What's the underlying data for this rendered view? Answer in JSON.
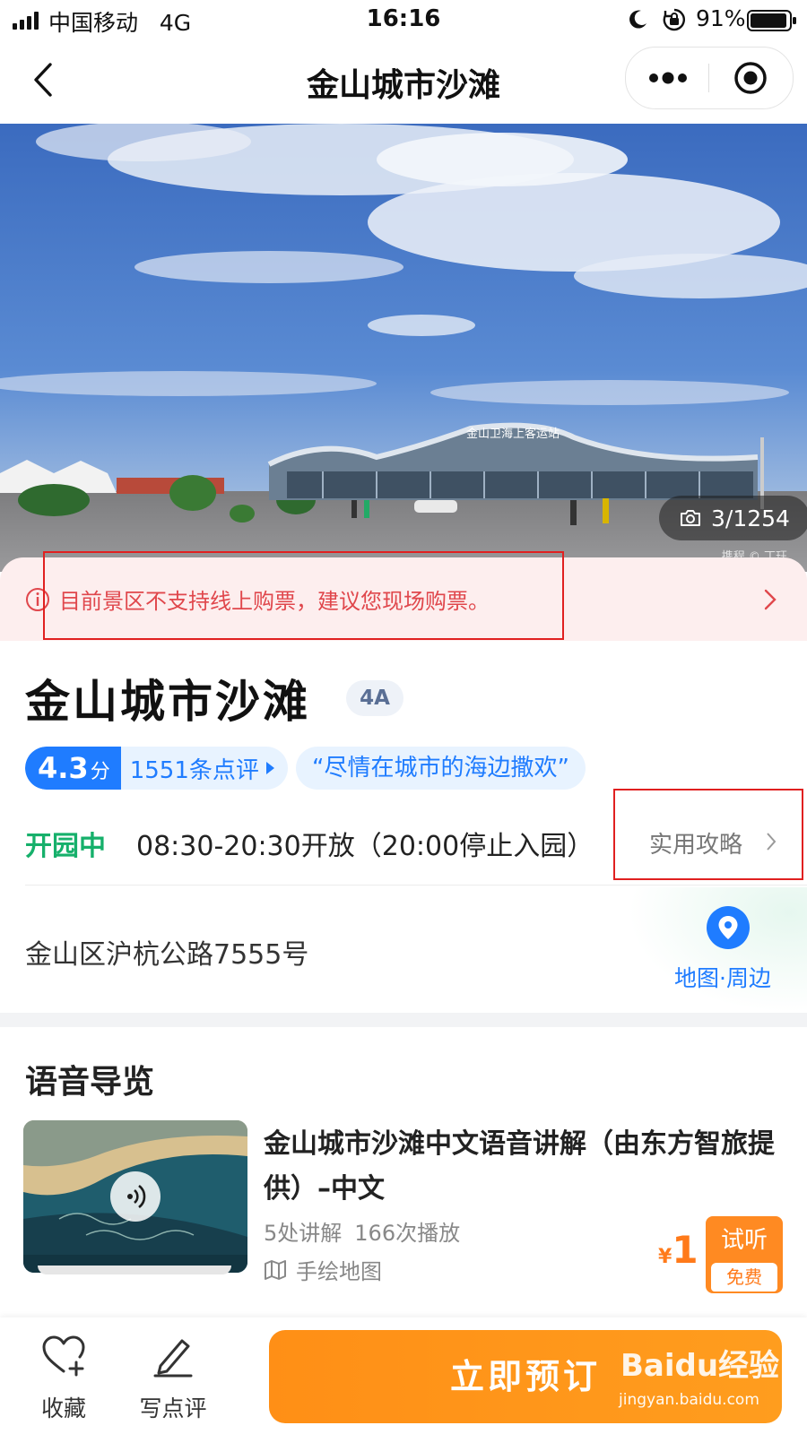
{
  "status_bar": {
    "carrier": "中国移动",
    "network": "4G",
    "time": "16:16",
    "battery_percent": "91%"
  },
  "nav": {
    "title": "金山城市沙滩",
    "icons": [
      "back-arrow-icon",
      "more-dots-icon",
      "target-circle-icon"
    ]
  },
  "hero": {
    "photo_counter": "3/1254",
    "building_sign": "金山卫海上客运站",
    "watermark": "携程 © 丁玨"
  },
  "notice": {
    "text": "目前景区不支持线上购票，建议您现场购票。"
  },
  "spot": {
    "name": "金山城市沙滩",
    "level": "4A",
    "score": "4.3",
    "score_unit": "分",
    "review_count": "1551条点评",
    "slogan": "“尽情在城市的海边撒欢”",
    "open_status": "开园中",
    "hours": "08:30-20:30开放（20:00停止入园）",
    "guide_link": "实用攻略",
    "address": "金山区沪杭公路7555号",
    "map_label": "地图·周边"
  },
  "audio": {
    "section_title": "语音导览",
    "title": "金山城市沙滩中文语音讲解（由东方智旅提供）–中文",
    "stats": [
      "5处讲解",
      "166次播放"
    ],
    "hand_map": "手绘地图",
    "price_symbol": "¥",
    "price": "1",
    "listen_label": "试听",
    "free_label": "免费"
  },
  "bottom": {
    "favorite_label": "收藏",
    "review_label": "写点评",
    "book_label": "立即预订"
  },
  "watermark": {
    "brand": "Baidu经验",
    "url": "jingyan.baidu.com"
  },
  "colors": {
    "accent_blue": "#1f7cff",
    "open_green": "#16b06b",
    "notice_red": "#e0474c",
    "orange": "#ff8f16",
    "annotation_red": "#e02020"
  }
}
